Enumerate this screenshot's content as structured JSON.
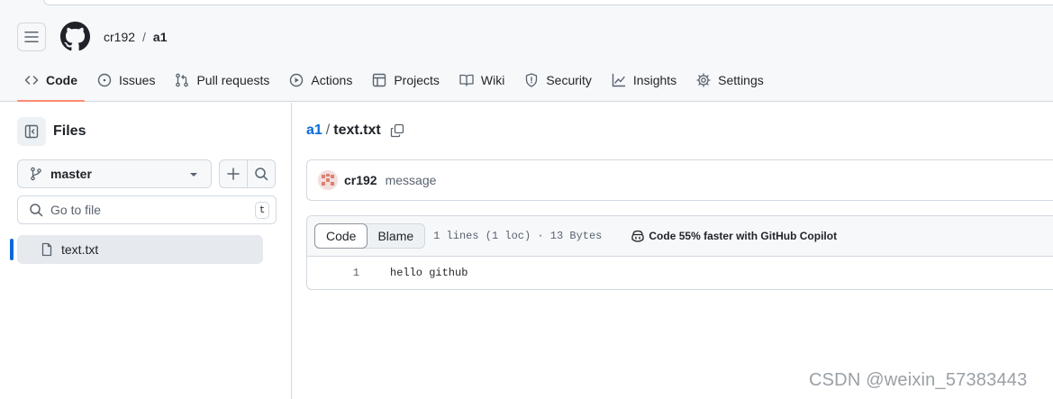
{
  "header": {
    "owner": "cr192",
    "separator": "/",
    "repo": "a1"
  },
  "nav": {
    "tabs": [
      {
        "label": "Code",
        "icon": "code-icon",
        "active": true
      },
      {
        "label": "Issues",
        "icon": "issue-icon"
      },
      {
        "label": "Pull requests",
        "icon": "pull-request-icon"
      },
      {
        "label": "Actions",
        "icon": "play-icon"
      },
      {
        "label": "Projects",
        "icon": "table-icon"
      },
      {
        "label": "Wiki",
        "icon": "book-icon"
      },
      {
        "label": "Security",
        "icon": "shield-icon"
      },
      {
        "label": "Insights",
        "icon": "graph-icon"
      },
      {
        "label": "Settings",
        "icon": "gear-icon"
      }
    ]
  },
  "sidebar": {
    "title": "Files",
    "branch": "master",
    "search_placeholder": "Go to file",
    "search_shortcut": "t",
    "files": [
      {
        "name": "text.txt",
        "selected": true
      }
    ]
  },
  "main": {
    "path_repo": "a1",
    "path_sep": "/",
    "path_file": "text.txt",
    "commit": {
      "author": "cr192",
      "message": "message"
    },
    "file": {
      "tab_code": "Code",
      "tab_blame": "Blame",
      "meta": "1 lines (1 loc) · 13 Bytes",
      "copilot": "Code 55% faster with GitHub Copilot",
      "lines": [
        {
          "number": "1",
          "text": "hello github"
        }
      ]
    }
  },
  "watermark": "CSDN @weixin_57383443",
  "colors": {
    "accent": "#0969da",
    "tab_underline": "#fd8c73",
    "border": "#d1d9e0"
  }
}
